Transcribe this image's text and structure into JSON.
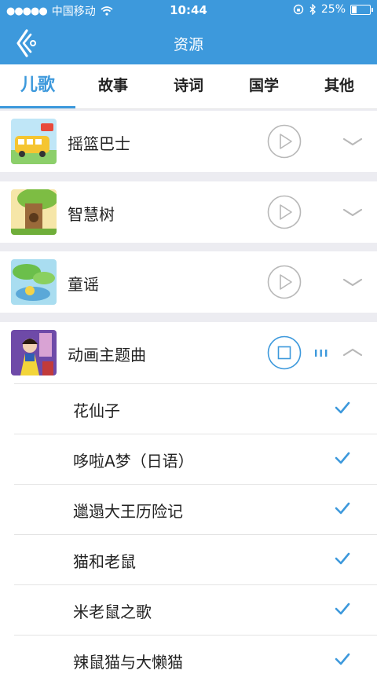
{
  "status": {
    "carrier": "中国移动",
    "time": "10:44",
    "battery": "25%",
    "battery_level": 0.25
  },
  "header": {
    "title": "资源"
  },
  "tabs": [
    {
      "label": "儿歌",
      "active": true
    },
    {
      "label": "故事"
    },
    {
      "label": "诗词"
    },
    {
      "label": "国学"
    },
    {
      "label": "其他"
    }
  ],
  "categories": [
    {
      "name": "摇篮巴士",
      "expanded": false
    },
    {
      "name": "智慧树",
      "expanded": false
    },
    {
      "name": "童谣",
      "expanded": false
    },
    {
      "name": "动画主题曲",
      "expanded": true,
      "playing": true
    }
  ],
  "songs": [
    {
      "title": "花仙子"
    },
    {
      "title": "哆啦A梦（日语）"
    },
    {
      "title": "邋遢大王历险记"
    },
    {
      "title": "猫和老鼠"
    },
    {
      "title": "米老鼠之歌"
    },
    {
      "title": "辣鼠猫与大懒猫"
    }
  ],
  "colors": {
    "accent": "#3d99dc",
    "separator": "#ececf1",
    "icon_gray": "#b8b8b8"
  }
}
